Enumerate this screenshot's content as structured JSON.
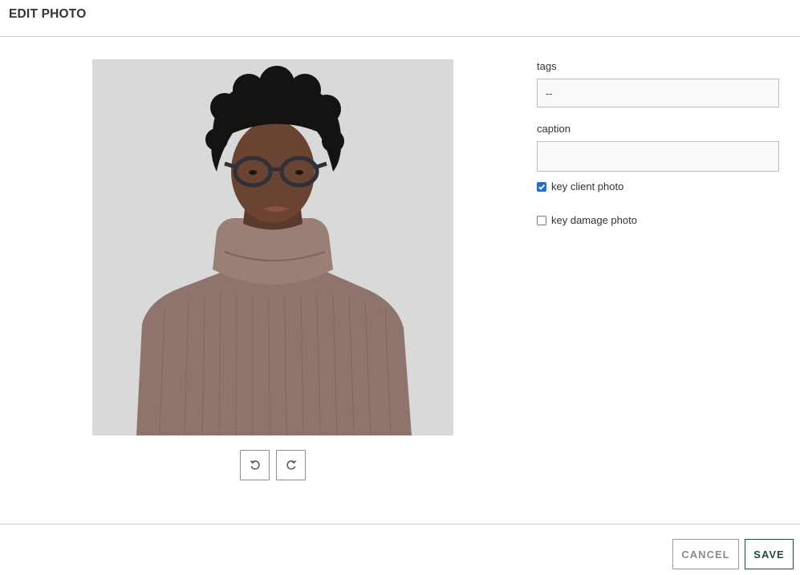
{
  "header": {
    "title": "EDIT PHOTO"
  },
  "photo": {
    "alt": "person wearing glasses and a brown turtleneck sweater",
    "controls": [
      {
        "icon": "rotate-left-icon"
      },
      {
        "icon": "rotate-right-icon"
      }
    ]
  },
  "form": {
    "tags": {
      "label": "tags",
      "value": "--"
    },
    "caption": {
      "label": "caption",
      "value": ""
    },
    "key_client_photo": {
      "label": "key client photo",
      "checked": true
    },
    "key_damage_photo": {
      "label": "key damage photo",
      "checked": false
    }
  },
  "footer": {
    "cancel_label": "CANCEL",
    "save_label": "SAVE"
  },
  "colors": {
    "save_accent": "#1f4d45",
    "checkbox_accent": "#1f6fd1",
    "photo_background": "#d9d9d9",
    "sweater": "#8e746c"
  }
}
